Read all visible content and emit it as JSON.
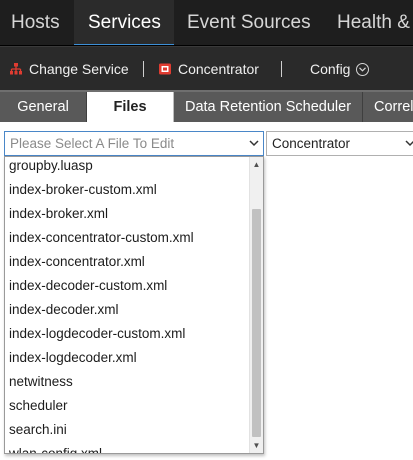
{
  "topnav": {
    "items": [
      "Hosts",
      "Services",
      "Event Sources",
      "Health &"
    ],
    "active": "Services"
  },
  "toolbar": {
    "change_service": "Change Service",
    "concentrator": "Concentrator",
    "config": "Config"
  },
  "tabs": [
    "General",
    "Files",
    "Data Retention Scheduler",
    "Correl"
  ],
  "file_select": {
    "placeholder": "Please Select A File To Edit"
  },
  "service_select": {
    "value": "Concentrator"
  },
  "dropdown": {
    "items": [
      "groupby.luasp",
      "index-broker-custom.xml",
      "index-broker.xml",
      "index-concentrator-custom.xml",
      "index-concentrator.xml",
      "index-decoder-custom.xml",
      "index-decoder.xml",
      "index-logdecoder-custom.xml",
      "index-logdecoder.xml",
      "netwitness",
      "scheduler",
      "search.ini",
      "wlan-config.xml"
    ]
  },
  "colors": {
    "nav_bg": "#1e1e1e",
    "toolbar_bg": "#2a2a2a",
    "tabs_bg": "#6f6f6f",
    "accent": "#3d8fd6",
    "icon_red": "#e03c31"
  }
}
